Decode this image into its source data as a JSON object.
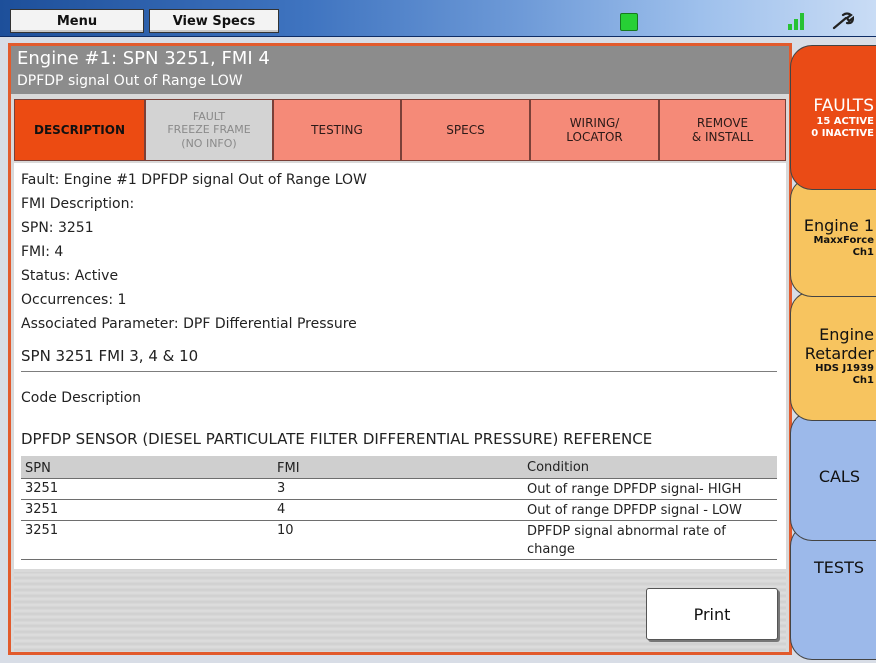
{
  "topbar": {
    "menu_label": "Menu",
    "view_specs_label": "View Specs",
    "status_icon": "green-status-led",
    "signal_icon": "signal-bars-icon",
    "tool_icon": "wrench-icon"
  },
  "fault": {
    "title": "Engine #1: SPN 3251, FMI 4",
    "subtitle": "DPFDP signal Out of Range LOW"
  },
  "tabs": [
    {
      "label": "DESCRIPTION",
      "state": "active"
    },
    {
      "label": "FAULT\nFREEZE FRAME\n(NO INFO)",
      "state": "disabled"
    },
    {
      "label": "TESTING",
      "state": "normal"
    },
    {
      "label": "SPECS",
      "state": "normal"
    },
    {
      "label": "WIRING/\nLOCATOR",
      "state": "normal"
    },
    {
      "label": "REMOVE\n& INSTALL",
      "state": "normal"
    }
  ],
  "details": {
    "fault_line": "Fault: Engine #1 DPFDP signal Out of Range LOW",
    "fmi_description": "FMI Description:",
    "spn": "SPN: 3251",
    "fmi": "FMI: 4",
    "status": "Status: Active",
    "occurrences": "Occurrences: 1",
    "associated_parameter": "Associated Parameter: DPF Differential Pressure"
  },
  "code_section": {
    "heading": "SPN 3251 FMI 3, 4 & 10",
    "code_description_label": "Code Description",
    "table_title": "DPFDP SENSOR (DIESEL PARTICULATE FILTER DIFFERENTIAL PRESSURE) REFERENCE",
    "columns": [
      "SPN",
      "FMI",
      "Condition"
    ],
    "rows": [
      [
        "3251",
        "3",
        "Out of range DPFDP signal- HIGH"
      ],
      [
        "3251",
        "4",
        "Out of range DPFDP signal - LOW"
      ],
      [
        "3251",
        "10",
        "DPFDP signal abnormal rate of change"
      ]
    ]
  },
  "footer": {
    "print_label": "Print"
  },
  "side_tabs": {
    "faults": {
      "title": "FAULTS",
      "line1": "15 ACTIVE",
      "line2": "0 INACTIVE"
    },
    "engine1": {
      "title": "Engine 1",
      "line1": "MaxxForce",
      "line2": "Ch1"
    },
    "retarder": {
      "title1": "Engine",
      "title2": "Retarder",
      "line1": "HDS J1939",
      "line2": "Ch1"
    },
    "cals": {
      "title": "CALS"
    },
    "tests": {
      "title": "TESTS"
    }
  },
  "colors": {
    "active_tab": "#ec4b12",
    "tab": "#f58a78",
    "panel_border": "#e25b2d",
    "engine_tab": "#f7c45f",
    "blue_tab": "#9cb9ea"
  }
}
